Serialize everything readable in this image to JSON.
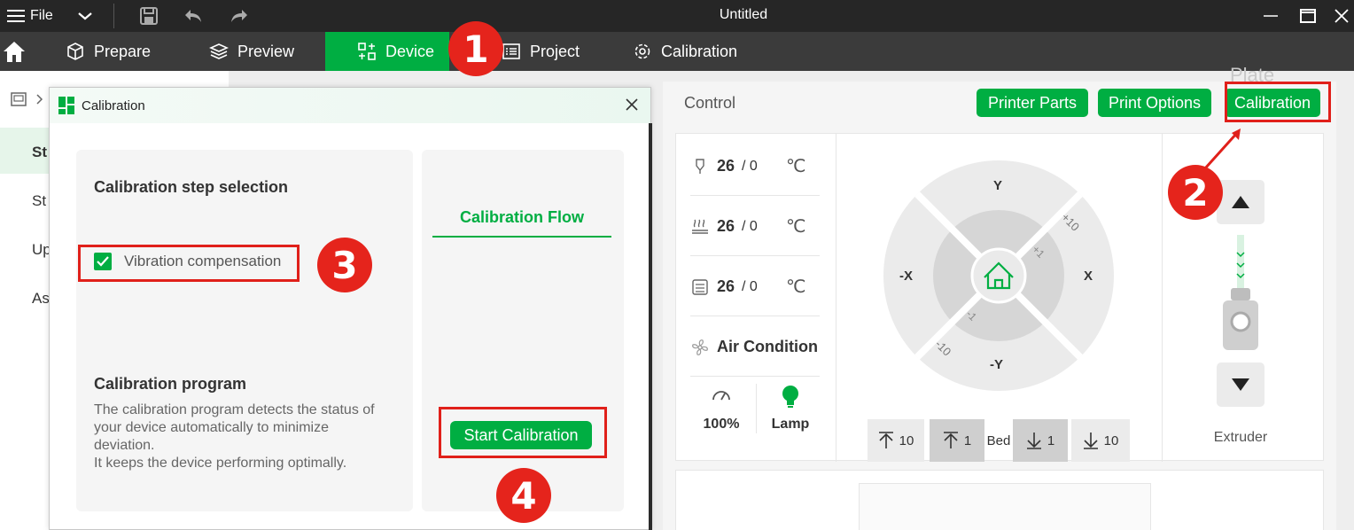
{
  "titlebar": {
    "file_label": "File",
    "window_title": "Untitled"
  },
  "nav": {
    "items": [
      "Prepare",
      "Preview",
      "Device",
      "Project",
      "Calibration"
    ],
    "active": "Device"
  },
  "left_panel": {
    "items": [
      "St",
      "St",
      "Up",
      "As"
    ]
  },
  "background_peek": "Plate",
  "control": {
    "title": "Control",
    "buttons": {
      "printer_parts": "Printer Parts",
      "print_options": "Print Options",
      "calibration": "Calibration"
    },
    "temps": [
      {
        "icon": "nozzle-icon",
        "current": "26",
        "target": "/ 0",
        "unit": "℃"
      },
      {
        "icon": "heatbed-icon",
        "current": "26",
        "target": "/ 0",
        "unit": "℃"
      },
      {
        "icon": "chamber-icon",
        "current": "26",
        "target": "/ 0",
        "unit": "℃"
      }
    ],
    "air_condition": "Air Condition",
    "fan_percent": "100%",
    "lamp_label": "Lamp",
    "jog": {
      "y_plus": "Y",
      "y_minus": "-Y",
      "x_plus": "X",
      "x_minus": "-X",
      "step_10": "+10",
      "step_1": "+1",
      "step_m1": "-1",
      "step_m10": "-10"
    },
    "bed": {
      "label": "Bed",
      "up10": "10",
      "up1": "1",
      "down1": "1",
      "down10": "10"
    },
    "extruder_label": "Extruder"
  },
  "modal": {
    "title": "Calibration",
    "step_selection_title": "Calibration step selection",
    "vibration_label": "Vibration compensation",
    "program_title": "Calibration program",
    "program_desc_1": "The calibration program detects the status of your device automatically to minimize deviation.",
    "program_desc_2": "It keeps the device performing optimally.",
    "flow_tab": "Calibration Flow",
    "start_button": "Start Calibration"
  },
  "annotations": {
    "badge_1": "1",
    "badge_2": "2",
    "badge_3": "3",
    "badge_4": "4"
  },
  "colors": {
    "accent": "#00ae42",
    "annotation_red": "#e0201a",
    "nav_bg": "#3b3b3b",
    "title_bg": "#262626"
  }
}
